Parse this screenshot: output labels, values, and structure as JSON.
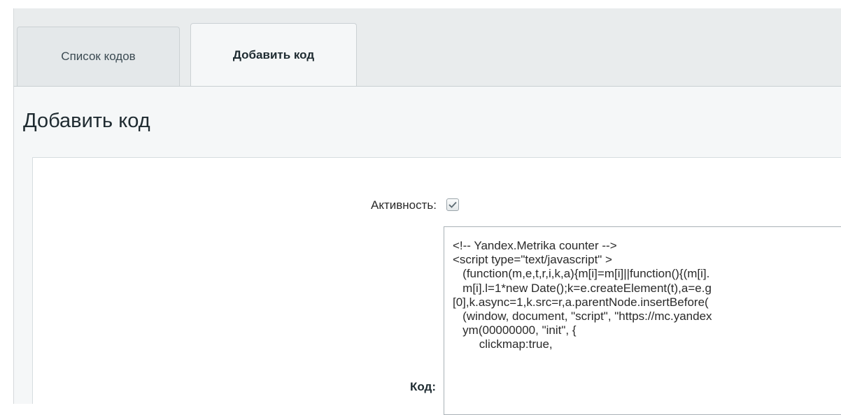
{
  "tabs": {
    "list_label": "Список кодов",
    "add_label": "Добавить код"
  },
  "page": {
    "title": "Добавить код"
  },
  "form": {
    "active_label": "Активность:",
    "active_checked": true,
    "code_label": "Код:",
    "code_lines": [
      "<!-- Yandex.Metrika counter -->",
      "<script type=\"text/javascript\" >",
      "   (function(m,e,t,r,i,k,a){m[i]=m[i]||function(){(m[i].",
      "   m[i].l=1*new Date();k=e.createElement(t),a=e.g",
      "[0],k.async=1,k.src=r,a.parentNode.insertBefore(",
      "   (window, document, \"script\", \"https://mc.yandex",
      "   ym(00000000, \"init\", {",
      "        clickmap:true,"
    ]
  }
}
